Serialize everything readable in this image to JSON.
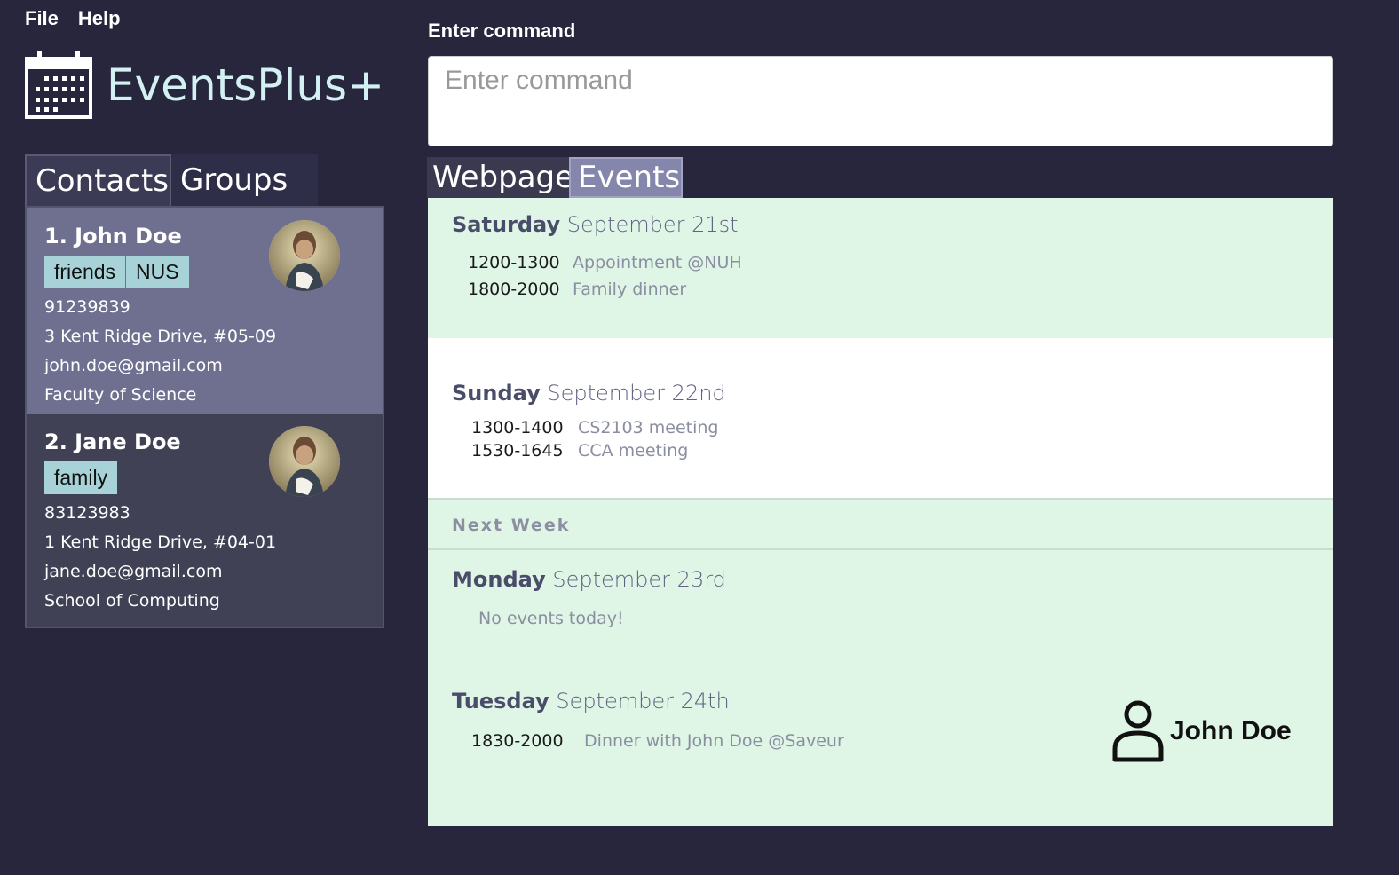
{
  "menu": {
    "file": "File",
    "help": "Help"
  },
  "app": {
    "title": "EventsPlus+"
  },
  "left_tabs": {
    "contacts": "Contacts",
    "groups": "Groups"
  },
  "contacts": [
    {
      "name": "1. John Doe",
      "tags": [
        "friends",
        "NUS"
      ],
      "phone": "91239839",
      "address": "3 Kent Ridge Drive, #05-09",
      "email": "john.doe@gmail.com",
      "faculty": "Faculty of Science"
    },
    {
      "name": "2. Jane Doe",
      "tags": [
        "family"
      ],
      "phone": "83123983",
      "address": "1 Kent Ridge Drive, #04-01",
      "email": "jane.doe@gmail.com",
      "faculty": "School of Computing"
    }
  ],
  "command": {
    "label": "Enter command",
    "placeholder": "Enter command"
  },
  "right_tabs": {
    "webpage": "Webpage",
    "events": "Events"
  },
  "events": {
    "saturday": {
      "weekday": "Saturday",
      "date": "September 21st",
      "items": [
        {
          "time": "1200-1300",
          "desc": "Appointment @NUH"
        },
        {
          "time": "1800-2000",
          "desc": "Family dinner"
        }
      ]
    },
    "sunday": {
      "weekday": "Sunday",
      "date": "September 22nd",
      "items": [
        {
          "time": "1300-1400",
          "desc": "CS2103 meeting"
        },
        {
          "time": "1530-1645",
          "desc": "CCA meeting"
        }
      ]
    },
    "next_week_label": "Next Week",
    "monday": {
      "weekday": "Monday",
      "date": "September 23rd",
      "empty": "No events today!"
    },
    "tuesday": {
      "weekday": "Tuesday",
      "date": "September 24th",
      "items": [
        {
          "time": "1830-2000",
          "desc": "Dinner with John Doe @Saveur"
        }
      ]
    },
    "person": {
      "name": "John Doe",
      "icon": "person-icon"
    }
  }
}
